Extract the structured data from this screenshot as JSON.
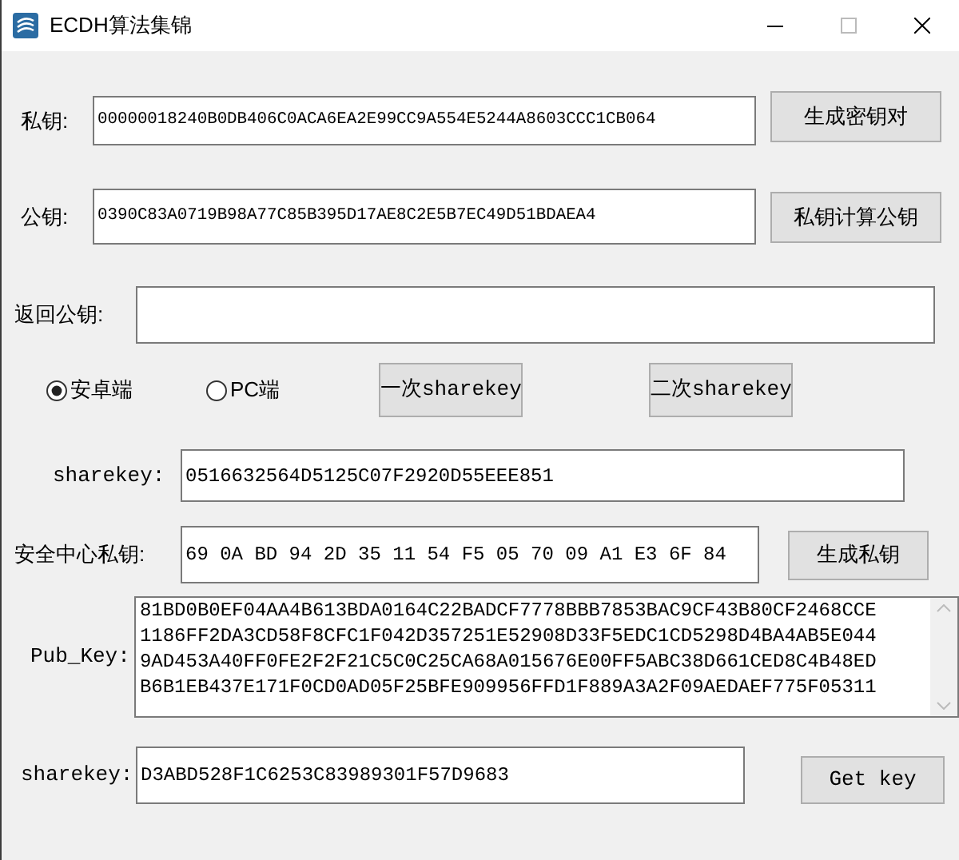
{
  "window": {
    "title": "ECDH算法集锦"
  },
  "private_key": {
    "label": "私钥:",
    "value": "00000018240B0DB406C0ACA6EA2E99CC9A554E5244A8603CCC1CB064",
    "button": "生成密钥对"
  },
  "public_key": {
    "label": "公钥:",
    "value": "0390C83A0719B98A77C85B395D17AE8C2E5B7EC49D51BDAEA4",
    "button": "私钥计算公钥"
  },
  "return_public_key": {
    "label": "返回公钥:"
  },
  "platforms": [
    {
      "label": "安卓端",
      "selected": true
    },
    {
      "label": "PC端",
      "selected": false
    }
  ],
  "sharekey_buttons": [
    "一次sharekey",
    "二次sharekey"
  ],
  "sharekey": {
    "label": "sharekey:",
    "value": "0516632564D5125C07F2920D55EEE851"
  },
  "security_center_key": {
    "label": "安全中心私钥:",
    "value": "69 0A BD 94 2D 35 11 54 F5 05 70 09 A1 E3 6F 84",
    "button": "生成私钥"
  },
  "pub_key": {
    "label": "Pub_Key:",
    "value": "81BD0B0EF04AA4B613BDA0164C22BADCF7778BBB7853BAC9CF43B80CF2468CCE1186FF2DA3CD58F8CFC1F042D357251E52908D33F5EDC1CD5298D4BA4AB5E0449AD453A40FF0FE2F2F21C5C0C25CA68A015676E00FF5ABC38D661CED8C4B48EDB6B1EB437E171F0CD0AD05F25BFE909956FFD1F889A3A2F09AEDAEF775F05311"
  },
  "final_sharekey": {
    "label": "sharekey:",
    "value": "D3ABD528F1C6253C83989301F57D9683",
    "button": "Get key"
  }
}
